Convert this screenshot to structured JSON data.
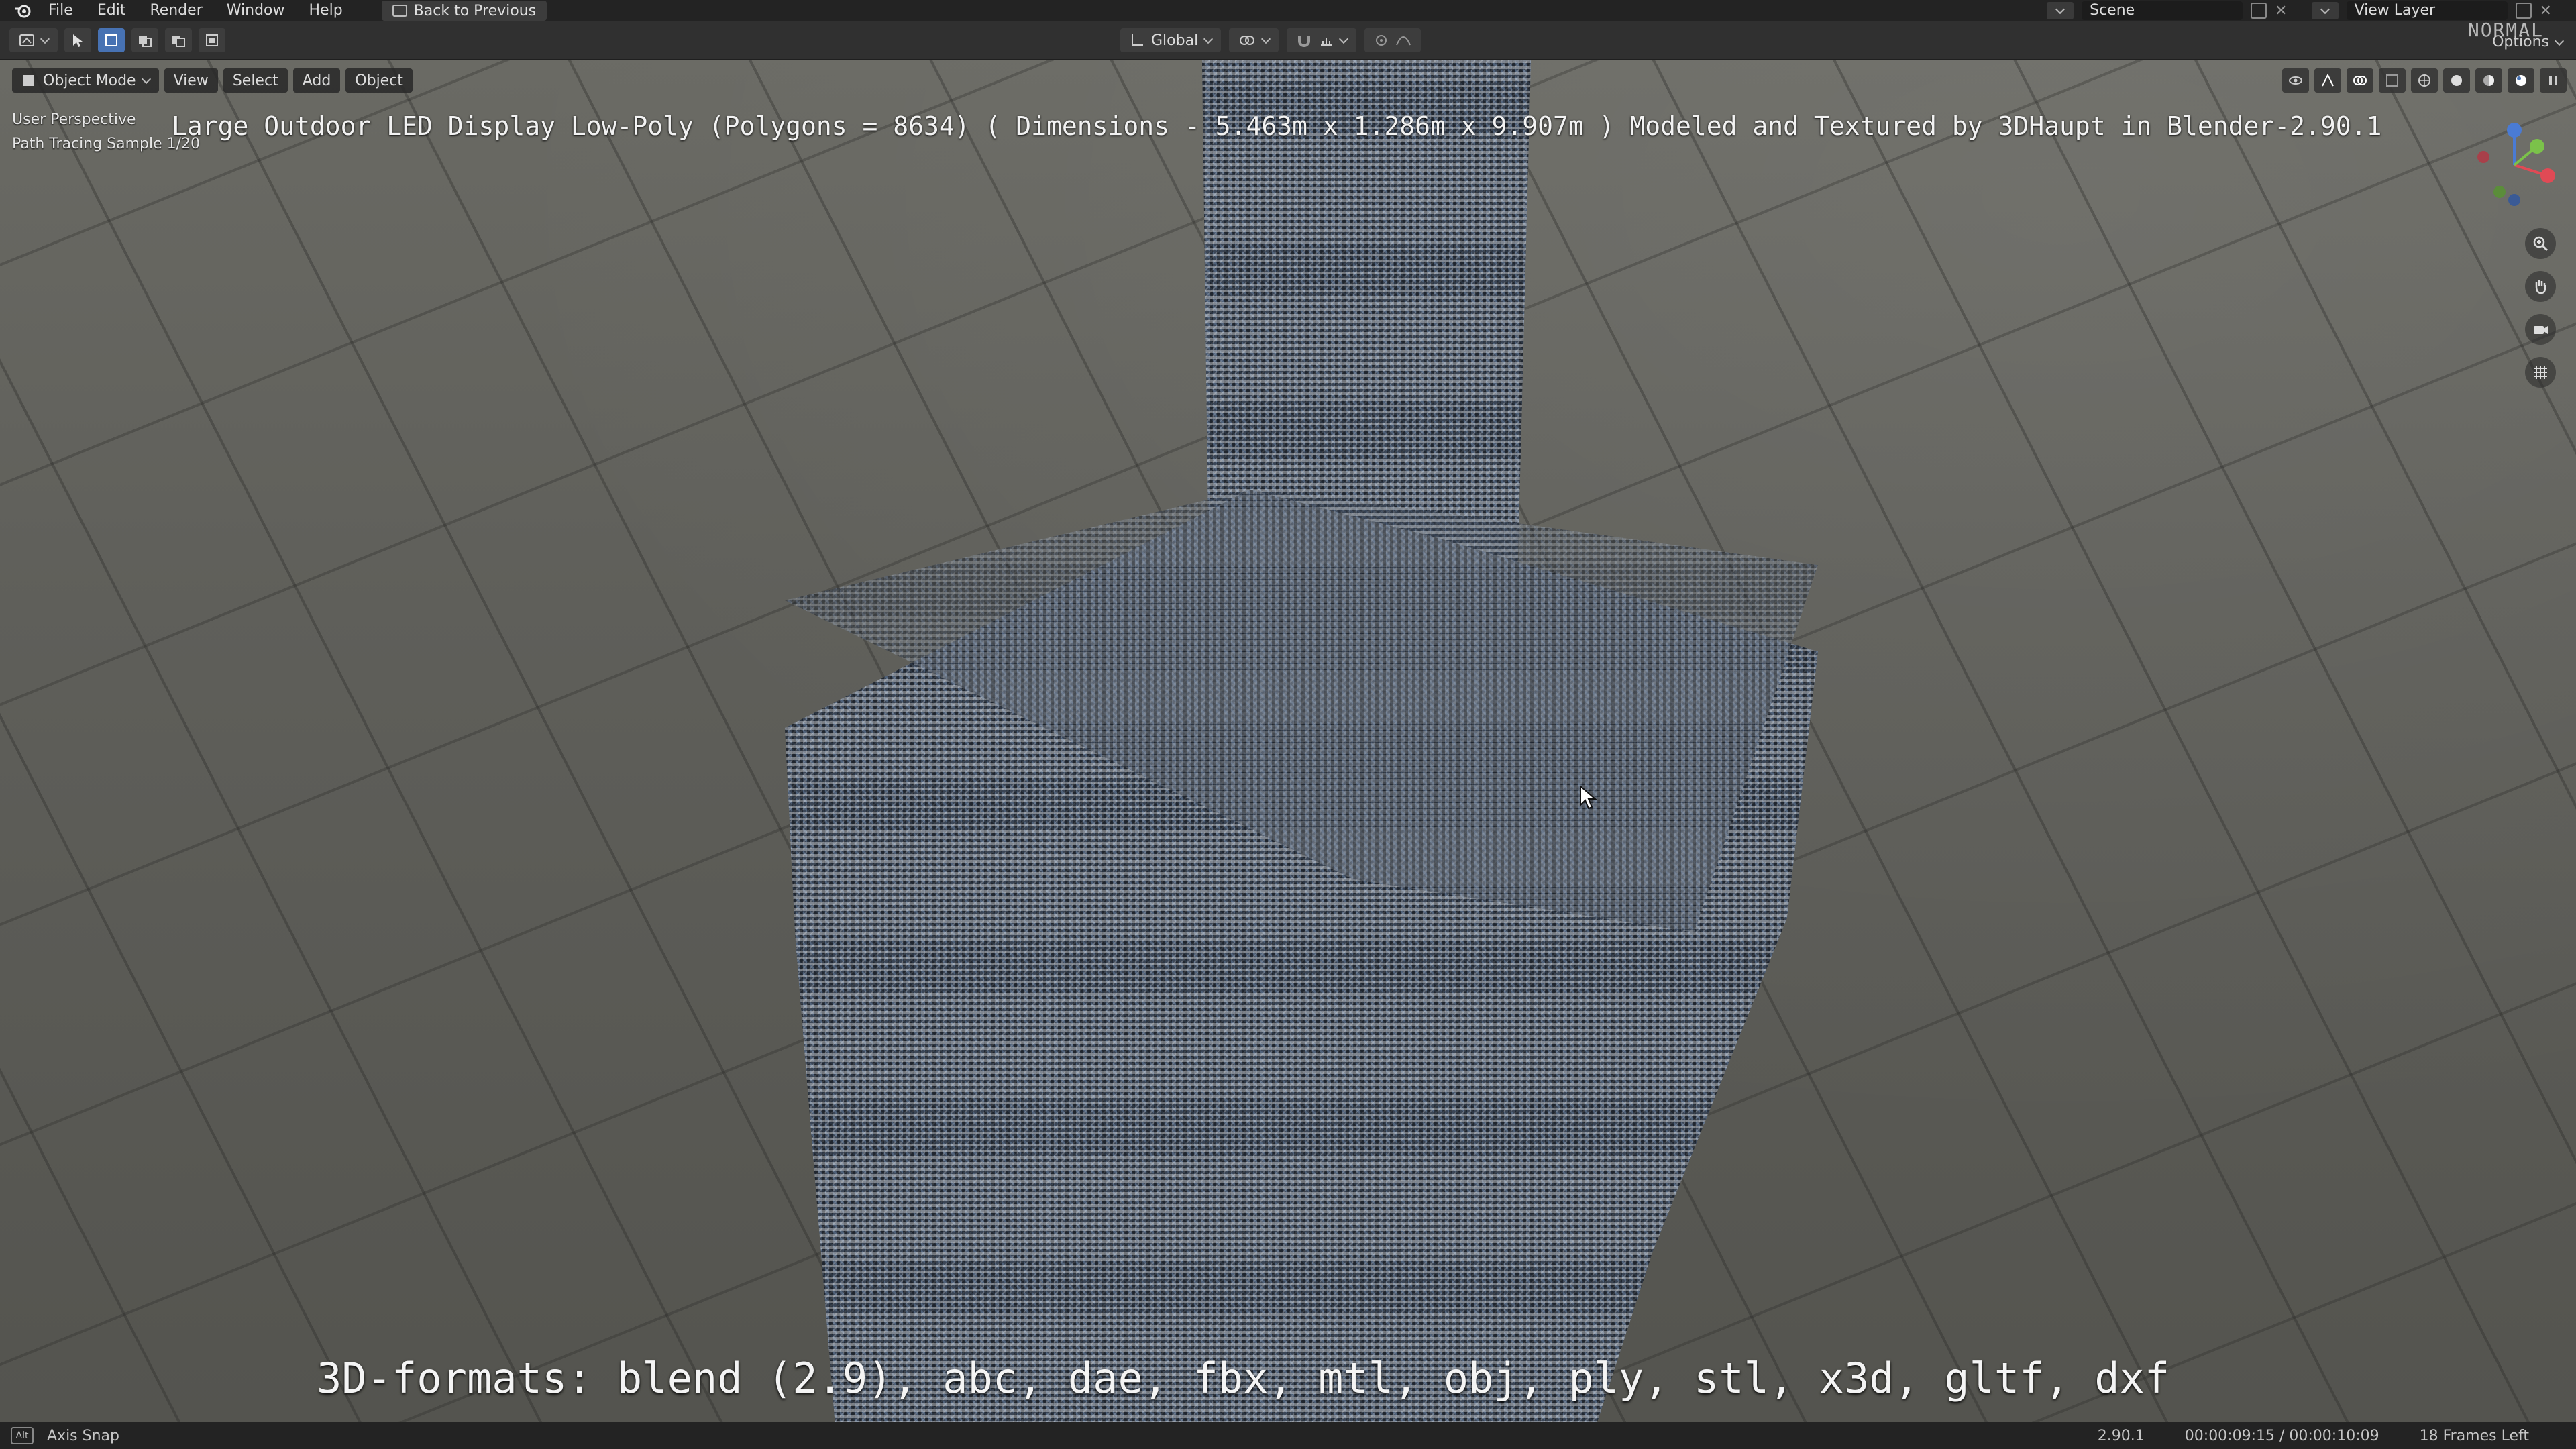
{
  "menu": {
    "items": [
      "File",
      "Edit",
      "Render",
      "Window",
      "Help"
    ],
    "back_button": "Back to Previous",
    "scene_label": "Scene",
    "view_layer_label": "View Layer"
  },
  "header": {
    "transform_orientation": "Global",
    "normal_label": "NORMAL",
    "options_label": "Options"
  },
  "viewport": {
    "mode_label": "Object Mode",
    "menus": [
      "View",
      "Select",
      "Add",
      "Object"
    ],
    "info_line1": "User Perspective",
    "info_line2": "Path Tracing Sample 1/20",
    "overlay_title": "Large Outdoor LED Display Low-Poly (Polygons = 8634) ( Dimensions - 5.463m x 1.286m x 9.907m ) Modeled and Textured by 3DHaupt in Blender-2.90.1",
    "overlay_formats": "3D-formats: blend (2.9), abc, dae, fbx, mtl, obj, ply, stl, x3d, gltf, dxf"
  },
  "status": {
    "key_label": "Alt",
    "hint": "Axis Snap",
    "version": "2.90.1",
    "timecode": "00:00:09:15 / 00:00:10:09",
    "frames_left": "18 Frames Left"
  },
  "colors": {
    "accent": "#4772b3",
    "bg_dark": "#232323",
    "header_bg": "#303030"
  },
  "icons": [
    "blender-logo-icon",
    "back-icon",
    "select-box-icon",
    "zoom-icon",
    "hand-icon",
    "camera-icon",
    "grid-icon",
    "cursor-icon"
  ]
}
